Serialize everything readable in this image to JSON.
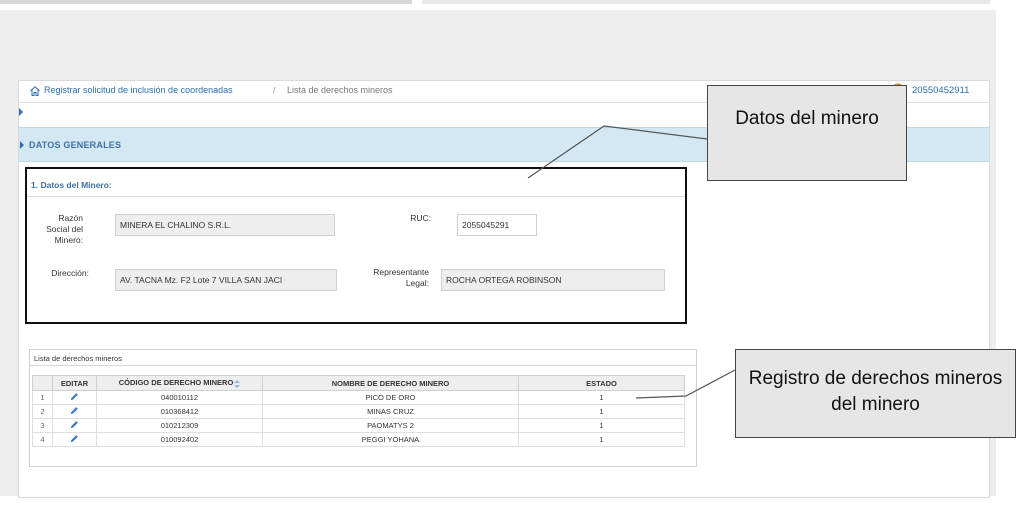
{
  "breadcrumb": {
    "link": "Registrar solicitud de inclusión de coordenadas",
    "separator": "/",
    "current": "Lista de derechos mineros",
    "separator2": "/"
  },
  "user": {
    "id": "20550452911"
  },
  "section": {
    "title": "DATOS GENERALES"
  },
  "miner": {
    "heading": "1. Datos del Minero:",
    "razon_label": "Razón Social del Minero:",
    "razon_value": "MINERA EL CHALINO S.R.L.",
    "ruc_label": "RUC:",
    "ruc_value": "2055045291",
    "direccion_label": "Dirección:",
    "direccion_value": "AV. TACNA    Mz. F2 Lote  7  VILLA SAN JACI",
    "representante_label": "Representante Legal:",
    "representante_value": "ROCHA ORTEGA ROBINSON"
  },
  "grid": {
    "caption": "Lista de derechos mineros",
    "columns": [
      "EDITAR",
      "CÓDIGO DE DERECHO MINERO",
      "NOMBRE DE DERECHO MINERO",
      "ESTADO"
    ],
    "rows": [
      {
        "n": "1",
        "codigo": "040010112",
        "nombre": "PICO DE ORO",
        "estado": "1"
      },
      {
        "n": "2",
        "codigo": "010368412",
        "nombre": "MINAS CRUZ",
        "estado": "1"
      },
      {
        "n": "3",
        "codigo": "010212309",
        "nombre": "PAOMATYS 2",
        "estado": "1"
      },
      {
        "n": "4",
        "codigo": "010092402",
        "nombre": "PEGGI YOHANA",
        "estado": "1"
      }
    ]
  },
  "callouts": {
    "first": "Datos del minero",
    "second": "Registro de derechos mineros del minero"
  },
  "icons": {
    "home": "home-icon",
    "avatar": "user-avatar-icon",
    "edit": "pencil-icon",
    "sort": "sort-icon"
  },
  "colors": {
    "link": "#2a6fb5",
    "section_bg": "#d4e8f3",
    "heading": "#3d6fa8"
  }
}
